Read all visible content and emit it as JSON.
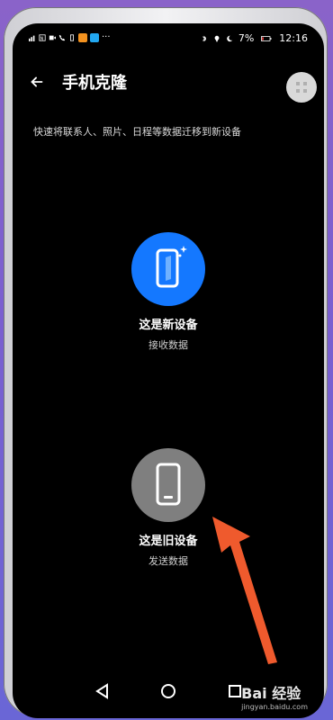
{
  "statusbar": {
    "time": "12:16",
    "battery": "7%",
    "icons": [
      "signal-icon",
      "nfc-icon",
      "video-icon",
      "phone-icon",
      "battery-small-icon",
      "app-orange-icon",
      "app-blue-icon",
      "dots-icon",
      "bluetooth-icon",
      "location-icon",
      "moon-icon"
    ]
  },
  "header": {
    "title": "手机克隆",
    "back_icon": "arrow-left-icon",
    "menu_icon": "grid-icon"
  },
  "description": "快速将联系人、照片、日程等数据迁移到新设备",
  "options": [
    {
      "label": "这是新设备",
      "sublabel": "接收数据",
      "color": "#1478ff",
      "icon": "phone-sparkle-icon"
    },
    {
      "label": "这是旧设备",
      "sublabel": "发送数据",
      "color": "#7f7f7f",
      "icon": "phone-icon"
    }
  ],
  "annotation": {
    "color": "#ef5a2d",
    "icon": "arrow-annotation"
  },
  "navbar": [
    "back-triangle-icon",
    "home-circle-icon",
    "recents-square-icon"
  ],
  "watermark": {
    "brand": "Bai 经验",
    "url": "jingyan.baidu.com"
  }
}
